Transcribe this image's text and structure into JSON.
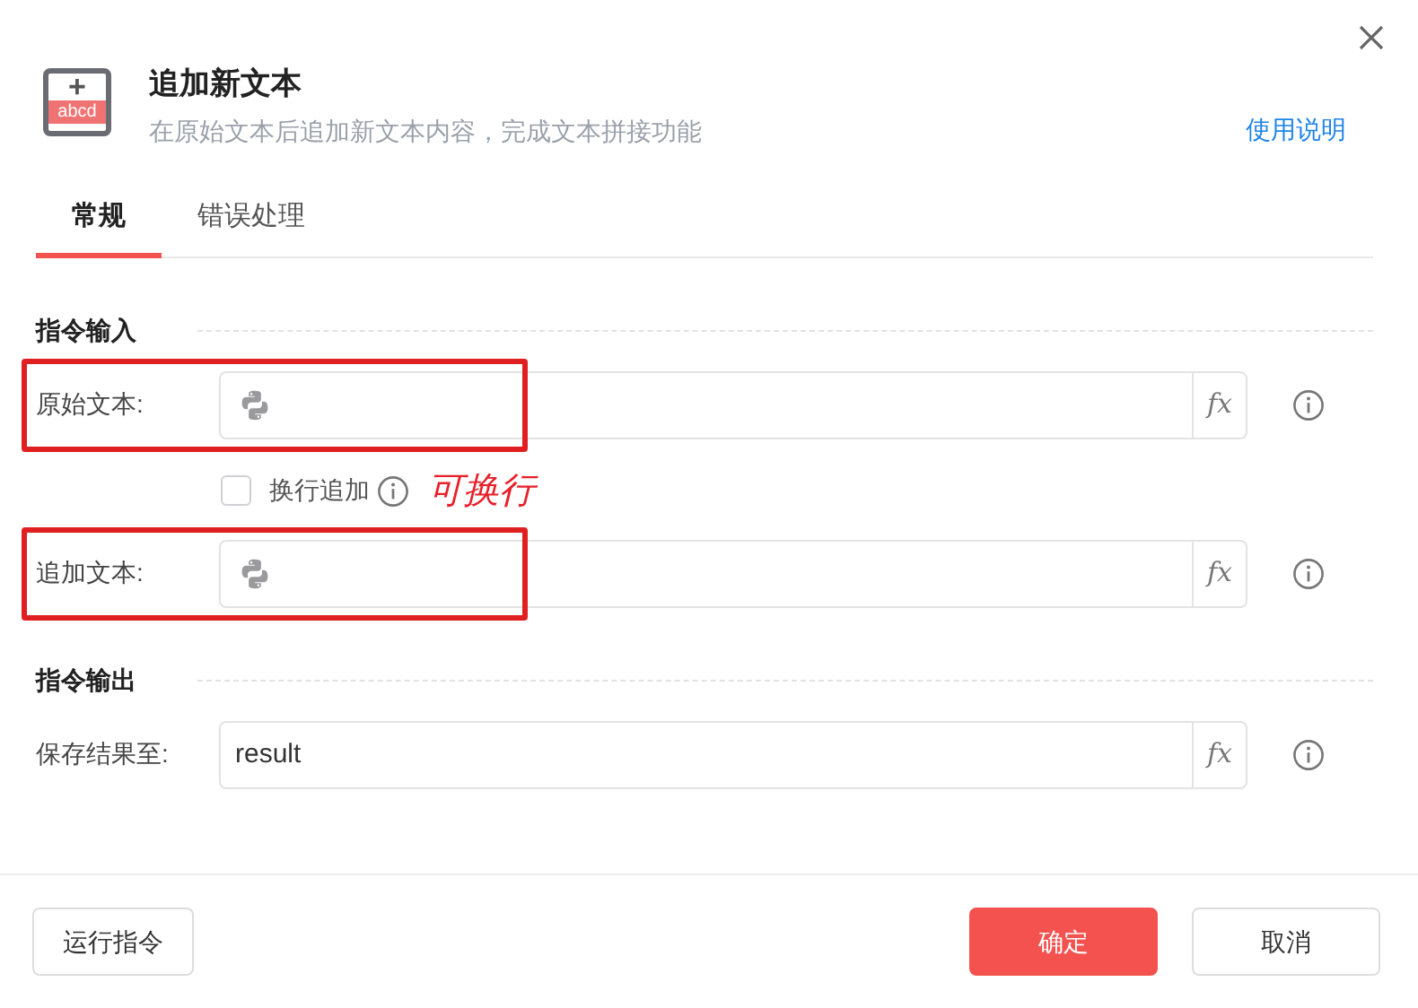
{
  "header": {
    "icon_plus": "+",
    "icon_text": "abcd",
    "title": "追加新文本",
    "subtitle": "在原始文本后追加新文本内容，完成文本拼接功能",
    "help_link": "使用说明"
  },
  "tabs": [
    {
      "label": "常规",
      "selected": true
    },
    {
      "label": "错误处理",
      "selected": false
    }
  ],
  "sections": [
    {
      "title": "指令输入",
      "rows": [
        {
          "kind": "field",
          "label": "原始文本:",
          "python": true,
          "value": "",
          "fx": "fx",
          "highlighted": true
        },
        {
          "kind": "checkbox",
          "label": "换行追加",
          "checked": false,
          "annotation": "可换行"
        },
        {
          "kind": "field",
          "label": "追加文本:",
          "python": true,
          "value": "",
          "fx": "fx",
          "highlighted": true
        }
      ]
    },
    {
      "title": "指令输出",
      "rows": [
        {
          "kind": "field",
          "label": "保存结果至:",
          "python": false,
          "value": "result",
          "fx": "fx",
          "highlighted": false
        }
      ]
    }
  ],
  "footer": {
    "run_button": "运行指令",
    "ok_button": "确定",
    "cancel_button": "取消"
  }
}
